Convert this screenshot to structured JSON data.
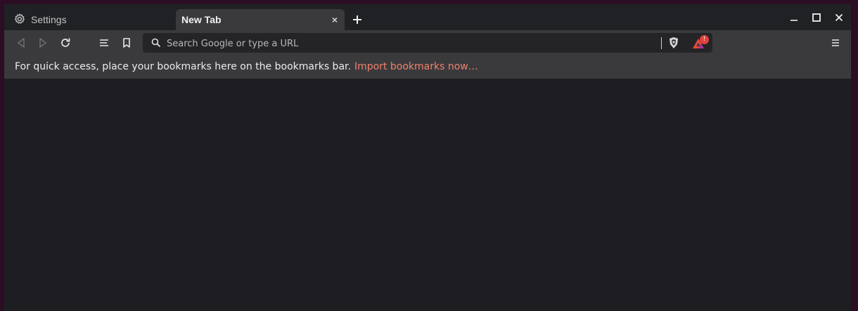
{
  "tabs": [
    {
      "label": "Settings",
      "icon": "gear-icon",
      "active": false
    },
    {
      "label": "New Tab",
      "active": true,
      "close": "×"
    }
  ],
  "new_tab_button": "new-tab",
  "window_controls": [
    "minimize",
    "maximize",
    "close"
  ],
  "toolbar": {
    "back": "back-icon",
    "forward": "forward-icon",
    "reload": "reload-icon",
    "reader": "reader-list-icon",
    "bookmark": "bookmark-icon",
    "menu": "hamburger-menu-icon"
  },
  "omnibox": {
    "placeholder": "Search Google or type a URL",
    "value": ""
  },
  "rewards": {
    "badge_count": "!"
  },
  "bookmarks_bar": {
    "message": "For quick access, place your bookmarks here on the bookmarks bar.",
    "link": "Import bookmarks now…"
  },
  "colors": {
    "accent_link": "#f0806a",
    "toolbar_bg": "#3a3a3d",
    "content_bg": "#1d1d22",
    "desktop_bg": "#2b0e23"
  }
}
